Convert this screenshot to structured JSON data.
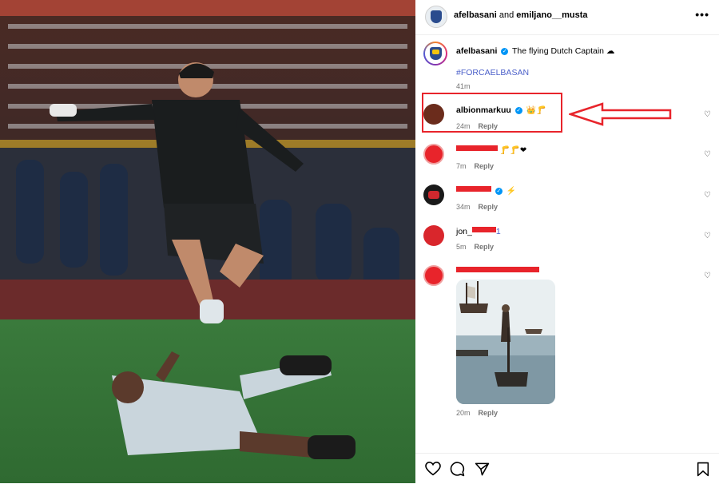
{
  "header": {
    "user1": "afelbasani",
    "connector": "and",
    "user2": "emiljano__musta",
    "more": "•••"
  },
  "caption": {
    "username": "afelbasani",
    "text": "The flying Dutch Captain",
    "emoji": "☁",
    "hashtag": "#FORCAELBASAN",
    "time": "41m"
  },
  "comments": [
    {
      "username": "albionmarkuu",
      "verified": "✓",
      "emoji": "👑🦵",
      "time": "24m",
      "reply": "Reply"
    },
    {
      "username": "",
      "emoji": "🦵🦵❤",
      "time": "7m",
      "reply": "Reply"
    },
    {
      "username": "",
      "verified": "✓",
      "emoji": "⚡",
      "time": "34m",
      "reply": "Reply"
    },
    {
      "username": "jon_",
      "suffix": "1",
      "time": "5m",
      "reply": "Reply"
    },
    {
      "username": "",
      "time": "20m",
      "reply": "Reply"
    }
  ],
  "colors": {
    "accent": "#0095f6",
    "highlight": "#e8242b",
    "hashtag": "#4b5fc9",
    "muted": "#737373"
  },
  "icons": [
    "heart-icon",
    "comment-icon",
    "share-icon",
    "bookmark-icon",
    "more-icon"
  ]
}
